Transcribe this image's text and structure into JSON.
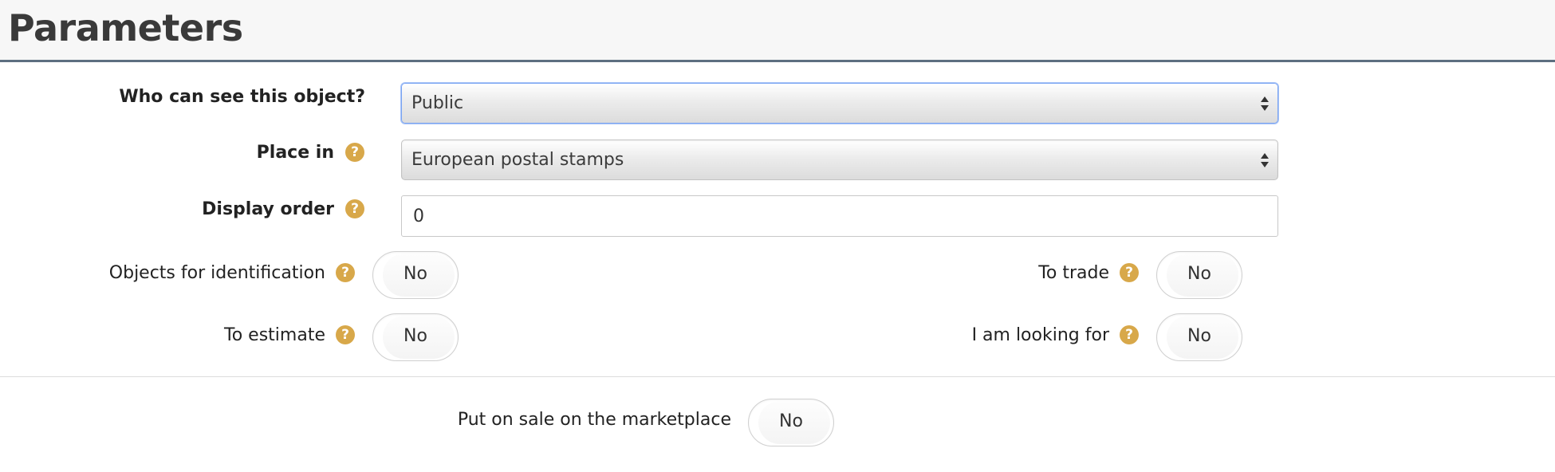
{
  "header": {
    "title": "Parameters"
  },
  "visibility": {
    "label": "Who can see this object?",
    "value": "Public"
  },
  "place": {
    "label": "Place in",
    "value": "European postal stamps"
  },
  "display_order": {
    "label": "Display order",
    "value": "0"
  },
  "toggles": {
    "identification": {
      "label": "Objects for identification",
      "value": "No"
    },
    "trade": {
      "label": "To trade",
      "value": "No"
    },
    "estimate": {
      "label": "To estimate",
      "value": "No"
    },
    "looking_for": {
      "label": "I am looking for",
      "value": "No"
    },
    "marketplace": {
      "label": "Put on sale on the marketplace",
      "value": "No"
    }
  },
  "icons": {
    "help": "question-circle-icon",
    "help_glyph": "?"
  },
  "colors": {
    "help_icon": "#d8a84a",
    "header_border": "#5d6f80",
    "focus_border": "#7aa4f2"
  }
}
